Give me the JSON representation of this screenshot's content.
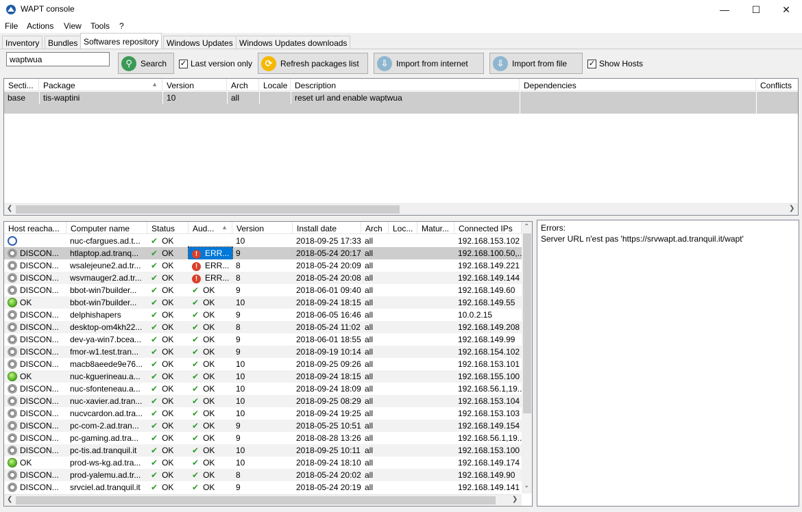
{
  "window": {
    "title": "WAPT console"
  },
  "menu": [
    "File",
    "Actions",
    "View",
    "Tools",
    "?"
  ],
  "tabs": [
    "Inventory",
    "Bundles",
    "Softwares repository",
    "Windows Updates",
    "Windows Updates downloads"
  ],
  "toolbar": {
    "search_value": "waptwua",
    "search_label": "Search",
    "last_version_label": "Last version only",
    "refresh_label": "Refresh packages list",
    "import_internet_label": "Import from internet",
    "import_file_label": "Import from file",
    "show_hosts_label": "Show Hosts"
  },
  "packages": {
    "headers": [
      "Secti...",
      "Package",
      "Version",
      "Arch",
      "Locale",
      "Description",
      "Dependencies",
      "Conflicts"
    ],
    "rows": [
      [
        "base",
        "tis-waptini",
        "10",
        "all",
        "",
        "reset url and enable waptwua",
        "",
        ""
      ]
    ]
  },
  "hosts": {
    "headers": [
      "Host reacha...",
      "Computer name",
      "Status",
      "Aud...",
      "Version",
      "Install date",
      "Arch",
      "Loc...",
      "Matur...",
      "Connected IPs"
    ],
    "rows": [
      {
        "reach": "",
        "reach_icon": "clock",
        "name": "nuc-cfargues.ad.t...",
        "status": "OK",
        "audit": "",
        "audit_icon": "none",
        "version": "10",
        "date": "2018-09-25 17:33",
        "arch": "all",
        "ips": "192.168.153.102"
      },
      {
        "reach": "DISCON...",
        "reach_icon": "disc",
        "name": "htlaptop.ad.tranq...",
        "status": "OK",
        "audit": "ERR...",
        "audit_icon": "err",
        "version": "9",
        "date": "2018-05-24 20:17",
        "arch": "all",
        "ips": "192.168.100.50,..."
      },
      {
        "reach": "DISCON...",
        "reach_icon": "disc",
        "name": "wsalejeune2.ad.tr...",
        "status": "OK",
        "audit": "ERR...",
        "audit_icon": "err",
        "version": "8",
        "date": "2018-05-24 20:09",
        "arch": "all",
        "ips": "192.168.149.221"
      },
      {
        "reach": "DISCON...",
        "reach_icon": "disc",
        "name": "wsvmauger2.ad.tr...",
        "status": "OK",
        "audit": "ERR...",
        "audit_icon": "err",
        "version": "8",
        "date": "2018-05-24 20:08",
        "arch": "all",
        "ips": "192.168.149.144"
      },
      {
        "reach": "DISCON...",
        "reach_icon": "disc",
        "name": "bbot-win7builder...",
        "status": "OK",
        "audit": "OK",
        "audit_icon": "ok",
        "version": "9",
        "date": "2018-06-01 09:40",
        "arch": "all",
        "ips": "192.168.149.60"
      },
      {
        "reach": "OK",
        "reach_icon": "ok",
        "name": "bbot-win7builder...",
        "status": "OK",
        "audit": "OK",
        "audit_icon": "ok",
        "version": "10",
        "date": "2018-09-24 18:15",
        "arch": "all",
        "ips": "192.168.149.55"
      },
      {
        "reach": "DISCON...",
        "reach_icon": "disc",
        "name": "delphishapers",
        "status": "OK",
        "audit": "OK",
        "audit_icon": "ok",
        "version": "9",
        "date": "2018-06-05 16:46",
        "arch": "all",
        "ips": "10.0.2.15"
      },
      {
        "reach": "DISCON...",
        "reach_icon": "disc",
        "name": "desktop-om4kh22...",
        "status": "OK",
        "audit": "OK",
        "audit_icon": "ok",
        "version": "8",
        "date": "2018-05-24 11:02",
        "arch": "all",
        "ips": "192.168.149.208"
      },
      {
        "reach": "DISCON...",
        "reach_icon": "disc",
        "name": "dev-ya-win7.bcea...",
        "status": "OK",
        "audit": "OK",
        "audit_icon": "ok",
        "version": "9",
        "date": "2018-06-01 18:55",
        "arch": "all",
        "ips": "192.168.149.99"
      },
      {
        "reach": "DISCON...",
        "reach_icon": "disc",
        "name": "fmor-w1.test.tran...",
        "status": "OK",
        "audit": "OK",
        "audit_icon": "ok",
        "version": "9",
        "date": "2018-09-19 10:14",
        "arch": "all",
        "ips": "192.168.154.102"
      },
      {
        "reach": "DISCON...",
        "reach_icon": "disc",
        "name": "macb8aeede9e76...",
        "status": "OK",
        "audit": "OK",
        "audit_icon": "ok",
        "version": "10",
        "date": "2018-09-25 09:26",
        "arch": "all",
        "ips": "192.168.153.101"
      },
      {
        "reach": "OK",
        "reach_icon": "ok",
        "name": "nuc-kguerineau.a...",
        "status": "OK",
        "audit": "OK",
        "audit_icon": "ok",
        "version": "10",
        "date": "2018-09-24 18:15",
        "arch": "all",
        "ips": "192.168.155.100"
      },
      {
        "reach": "DISCON...",
        "reach_icon": "disc",
        "name": "nuc-sfonteneau.a...",
        "status": "OK",
        "audit": "OK",
        "audit_icon": "ok",
        "version": "10",
        "date": "2018-09-24 18:09",
        "arch": "all",
        "ips": "192.168.56.1,19..."
      },
      {
        "reach": "DISCON...",
        "reach_icon": "disc",
        "name": "nuc-xavier.ad.tran...",
        "status": "OK",
        "audit": "OK",
        "audit_icon": "ok",
        "version": "10",
        "date": "2018-09-25 08:29",
        "arch": "all",
        "ips": "192.168.153.104"
      },
      {
        "reach": "DISCON...",
        "reach_icon": "disc",
        "name": "nucvcardon.ad.tra...",
        "status": "OK",
        "audit": "OK",
        "audit_icon": "ok",
        "version": "10",
        "date": "2018-09-24 19:25",
        "arch": "all",
        "ips": "192.168.153.103"
      },
      {
        "reach": "DISCON...",
        "reach_icon": "disc",
        "name": "pc-com-2.ad.tran...",
        "status": "OK",
        "audit": "OK",
        "audit_icon": "ok",
        "version": "9",
        "date": "2018-05-25 10:51",
        "arch": "all",
        "ips": "192.168.149.154"
      },
      {
        "reach": "DISCON...",
        "reach_icon": "disc",
        "name": "pc-gaming.ad.tra...",
        "status": "OK",
        "audit": "OK",
        "audit_icon": "ok",
        "version": "9",
        "date": "2018-08-28 13:26",
        "arch": "all",
        "ips": "192.168.56.1,19..."
      },
      {
        "reach": "DISCON...",
        "reach_icon": "disc",
        "name": "pc-tis.ad.tranquil.it",
        "status": "OK",
        "audit": "OK",
        "audit_icon": "ok",
        "version": "10",
        "date": "2018-09-25 10:11",
        "arch": "all",
        "ips": "192.168.153.100"
      },
      {
        "reach": "OK",
        "reach_icon": "ok",
        "name": "prod-ws-kg.ad.tra...",
        "status": "OK",
        "audit": "OK",
        "audit_icon": "ok",
        "version": "10",
        "date": "2018-09-24 18:10",
        "arch": "all",
        "ips": "192.168.149.174"
      },
      {
        "reach": "DISCON...",
        "reach_icon": "disc",
        "name": "prod-yalemu.ad.tr...",
        "status": "OK",
        "audit": "OK",
        "audit_icon": "ok",
        "version": "8",
        "date": "2018-05-24 20:02",
        "arch": "all",
        "ips": "192.168.149.90"
      },
      {
        "reach": "DISCON...",
        "reach_icon": "disc",
        "name": "srvciel.ad.tranquil.it",
        "status": "OK",
        "audit": "OK",
        "audit_icon": "ok",
        "version": "9",
        "date": "2018-05-24 20:19",
        "arch": "all",
        "ips": "192.168.149.141"
      }
    ]
  },
  "errors_panel": {
    "heading": "Errors:",
    "message": "Server URL n'est pas 'https://srvwapt.ad.tranquil.it/wapt'"
  },
  "colors": {
    "selected_row": "#cdcdcd",
    "audit_selected": "#0078d7"
  }
}
